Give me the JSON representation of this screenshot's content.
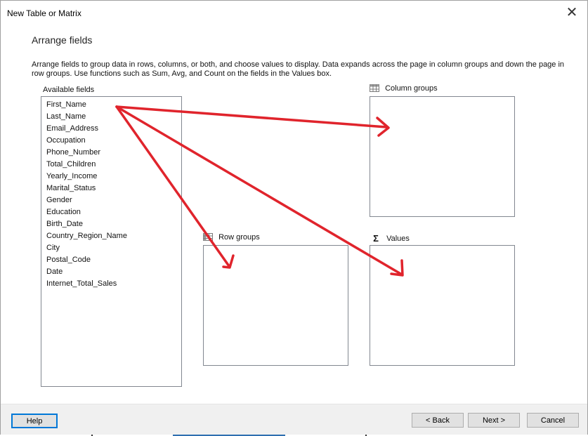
{
  "window": {
    "title": "New Table or Matrix"
  },
  "page": {
    "title": "Arrange fields",
    "instructions": "Arrange fields to group data in rows, columns, or both, and choose values to display. Data expands across the page in column groups and down the page in row groups.  Use functions such as Sum, Avg, and Count on the fields in the Values box."
  },
  "available_fields": {
    "label": "Available fields",
    "items": [
      "First_Name",
      "Last_Name",
      "Email_Address",
      "Occupation",
      "Phone_Number",
      "Total_Children",
      "Yearly_Income",
      "Marital_Status",
      "Gender",
      "Education",
      "Birth_Date",
      "Country_Region_Name",
      "City",
      "Postal_Code",
      "Date",
      "Internet_Total_Sales"
    ]
  },
  "column_groups": {
    "label": "Column groups",
    "icon": "grid-icon"
  },
  "row_groups": {
    "label": "Row groups",
    "icon": "grid-icon"
  },
  "values": {
    "label": "Values",
    "icon": "sigma-icon",
    "symbol": "Σ"
  },
  "buttons": {
    "help": "Help",
    "back": "< Back",
    "next": "Next >",
    "cancel": "Cancel"
  },
  "close_symbol": "✕",
  "annotation": {
    "arrow_color": "#e0242c"
  }
}
